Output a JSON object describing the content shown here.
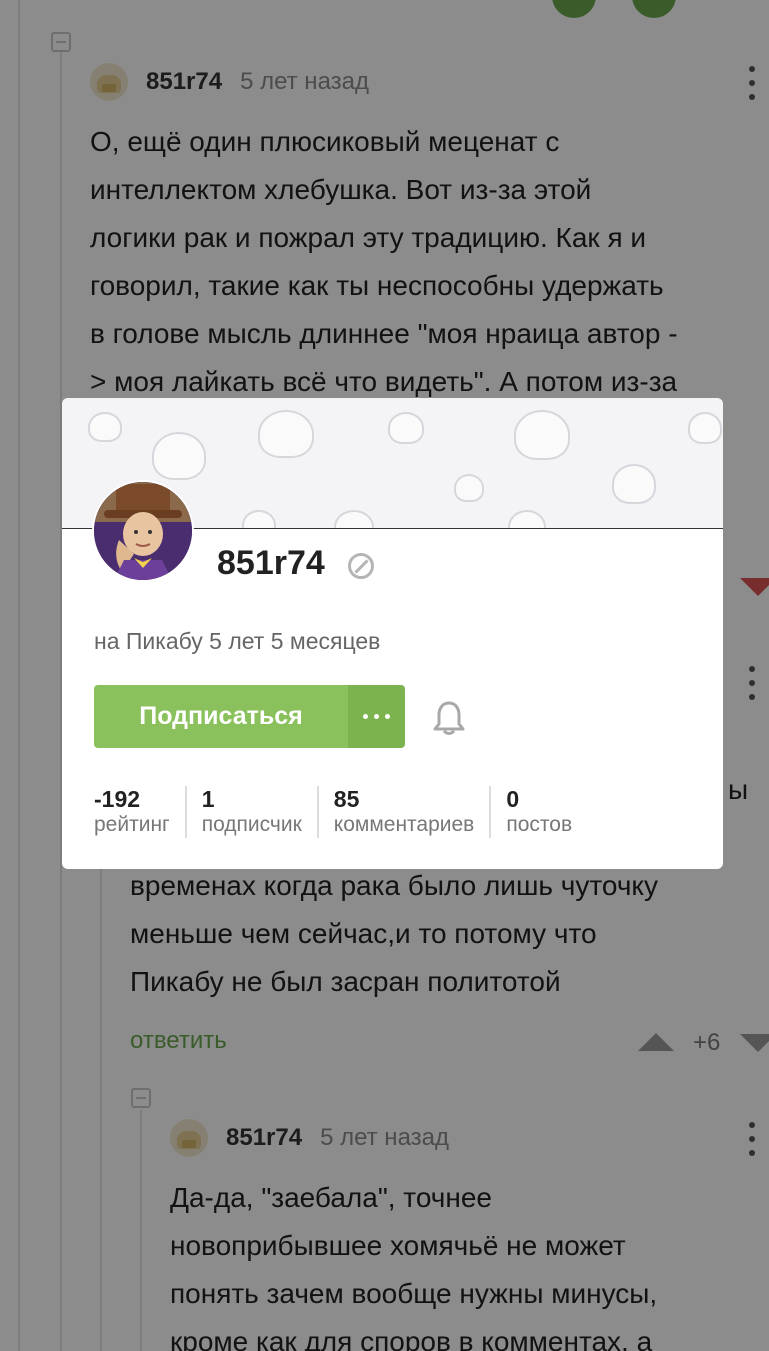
{
  "comments": [
    {
      "author": "851r74",
      "time": "5 лет назад",
      "text": "О, ещё один плюсиковый меценат с\nинтеллектом хлебушка. Вот из-за этой\nлогики рак и пожрал эту традицию. Как я и\nговорил, такие как ты неспособны удержать\nв голове мысль длиннее \"моя нраица автор -\n> моя лайкать всё что видеть\". А потом из-за"
    },
    {
      "text_tail": "ы",
      "text": "временах когда рака было лишь чуточку\nменьше чем сейчас,и то потому что\nПикабу не был засран политотой",
      "reply_label": "ответить",
      "score": "+6"
    },
    {
      "author": "851r74",
      "time": "5 лет назад",
      "text": "Да-да, \"заебала\", точнее\nновоприбывшее хомячьё не может\nпонять зачем вообще нужны минусы,\nкроме как для споров в комментах, а"
    }
  ],
  "profile_card": {
    "username": "851r74",
    "since": "на Пикабу 5 лет 5 месяцев",
    "subscribe_label": "Подписаться",
    "stats": [
      {
        "value": "-192",
        "label": "рейтинг"
      },
      {
        "value": "1",
        "label": "подписчик"
      },
      {
        "value": "85",
        "label": "комментариев"
      },
      {
        "value": "0",
        "label": "постов"
      }
    ]
  },
  "colors": {
    "accent_green": "#8ac15c",
    "link_green": "#6aa84f",
    "downvote_red": "#d9534f"
  },
  "icons": [
    "collapse-icon",
    "more-vertical-icon",
    "ban-icon",
    "more-horizontal-icon",
    "bell-icon",
    "upvote-icon",
    "downvote-icon"
  ]
}
